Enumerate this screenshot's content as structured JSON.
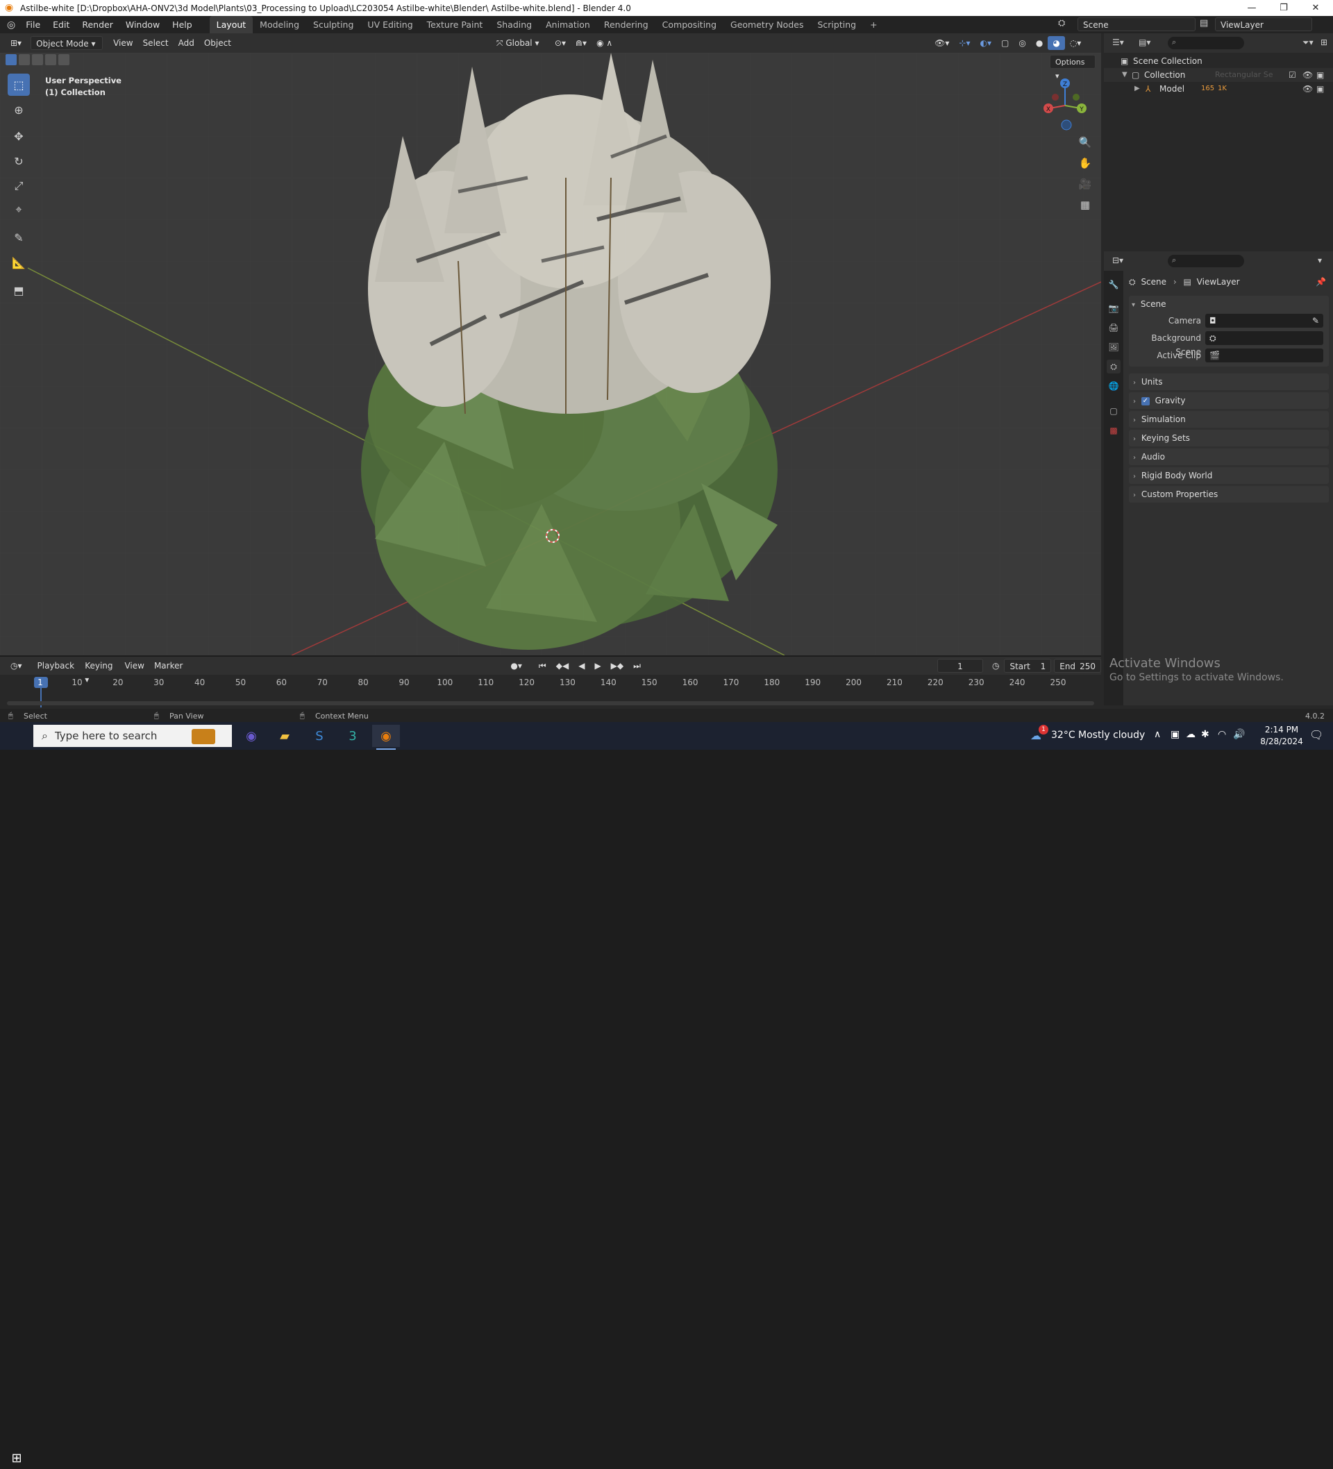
{
  "window": {
    "title": "Astilbe-white [D:\\Dropbox\\AHA-ONV2\\3d Model\\Plants\\03_Processing to Upload\\LC203054 Astilbe-white\\Blender\\ Astilbe-white.blend] - Blender 4.0",
    "minimize": "—",
    "maximize": "❐",
    "close": "✕"
  },
  "menus": [
    "File",
    "Edit",
    "Render",
    "Window",
    "Help"
  ],
  "workspaces": [
    "Layout",
    "Modeling",
    "Sculpting",
    "UV Editing",
    "Texture Paint",
    "Shading",
    "Animation",
    "Rendering",
    "Compositing",
    "Geometry Nodes",
    "Scripting",
    "+"
  ],
  "scene_selector": "Scene",
  "viewlayer_selector": "ViewLayer",
  "viewport_header": {
    "mode": "Object Mode",
    "menus": [
      "View",
      "Select",
      "Add",
      "Object"
    ],
    "orientation": "Global",
    "options": "Options"
  },
  "viewport": {
    "perspective": "User Perspective",
    "collection": "(1) Collection",
    "gizmo": {
      "z": "Z",
      "y": "Y",
      "x": "X"
    }
  },
  "outliner": {
    "scene_collection": "Scene Collection",
    "collection": "Collection",
    "model": "Model",
    "model_badges": [
      "165",
      "1K"
    ],
    "hidden_item": "Rectangular Se"
  },
  "properties": {
    "breadcrumb_scene": "Scene",
    "breadcrumb_viewlayer": "ViewLayer",
    "section": "Scene",
    "fields": [
      {
        "label": "Camera"
      },
      {
        "label": "Background Scene"
      },
      {
        "label": "Active Clip"
      }
    ],
    "panels": [
      "Units",
      "Gravity",
      "Simulation",
      "Keying Sets",
      "Audio",
      "Rigid Body World",
      "Custom Properties"
    ],
    "gravity_checked": true
  },
  "timeline": {
    "menus": [
      "Playback",
      "Keying",
      "View",
      "Marker"
    ],
    "current_frame": "1",
    "start_label": "Start",
    "start": "1",
    "end_label": "End",
    "end": "250",
    "ticks": [
      "1",
      "10",
      "20",
      "30",
      "40",
      "50",
      "60",
      "70",
      "80",
      "90",
      "100",
      "110",
      "120",
      "130",
      "140",
      "150",
      "160",
      "170",
      "180",
      "190",
      "200",
      "210",
      "220",
      "230",
      "240",
      "250"
    ]
  },
  "status_bar": {
    "select": "Select",
    "pan": "Pan View",
    "context": "Context Menu",
    "version": "4.0.2"
  },
  "watermark": {
    "line1": "Activate Windows",
    "line2": "Go to Settings to activate Windows."
  },
  "taskbar": {
    "search_placeholder": "Type here to search",
    "weather": "32°C  Mostly cloudy",
    "time": "2:14 PM",
    "date": "8/28/2024",
    "notification_count": "1"
  },
  "colors": {
    "accent": "#4772b3",
    "x_axis": "#d24a4a",
    "y_axis": "#8ab43c",
    "z_axis": "#3f7fd6"
  }
}
